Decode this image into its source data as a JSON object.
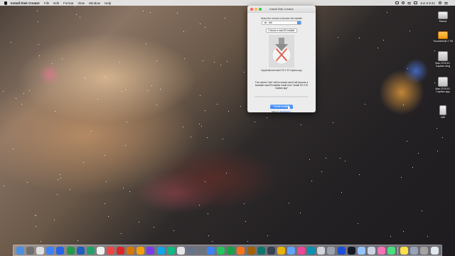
{
  "menubar": {
    "app_name": "Install Disk Creator",
    "items": [
      "File",
      "Edit",
      "Format",
      "View",
      "Window",
      "Help"
    ],
    "clock": "Jun 8  8:41"
  },
  "window": {
    "title": "Install Disk Creator",
    "prompt": "Select the volume to become the installer",
    "selected_volume": "sdh",
    "choose_button": "Choose a macOS Installer",
    "installer_name": "/Applications/Install OS X El Capitan.app",
    "warning": "The volume \"sdh\" will be erased and it will become a bootable macOS installer made from \"Install OS X El Capitan.app\"",
    "progress_fraction": 0,
    "create_button": "Create Installer",
    "credit_prefix": "Made by",
    "credit_link": "MacDaddy.io"
  },
  "desktop_icons": [
    {
      "label": "Macos",
      "kind": "hd"
    },
    {
      "label": "Thunderbolt 2 TB",
      "kind": "ext"
    },
    {
      "label": "Mac-OSX-El-Capitan.dmg",
      "kind": "dmg"
    },
    {
      "label": "Mac-OSX-El-Capitan.app",
      "kind": "dmg"
    },
    {
      "label": "sdh",
      "kind": "usb"
    }
  ],
  "dock": {
    "colors": [
      "#4a90e2",
      "#6e6e6e",
      "#e0e0e0",
      "#3b82f6",
      "#2563eb",
      "#1e9b4b",
      "#1f5fbf",
      "#22a06b",
      "#f2f2f2",
      "#ef4444",
      "#dc2626",
      "#d97706",
      "#f59e0b",
      "#7c3aed",
      "#0ea5e9",
      "#10b981",
      "#e5e7eb",
      "#64748b",
      "#6b7280",
      "#3b82f6",
      "#22c55e",
      "#16a34a",
      "#f97316",
      "#a16207",
      "#0f766e",
      "#374151",
      "#eab308",
      "#60a5fa",
      "#ec4899",
      "#0891b2",
      "#d1d5db",
      "#9ca3af",
      "#1d4ed8",
      "#111827",
      "#93c5fd",
      "#cbd5e1",
      "#f472b6",
      "#4ade80",
      "#fde047",
      "#94a3b8",
      "#a3a3a3",
      "#e2e8f0"
    ]
  }
}
